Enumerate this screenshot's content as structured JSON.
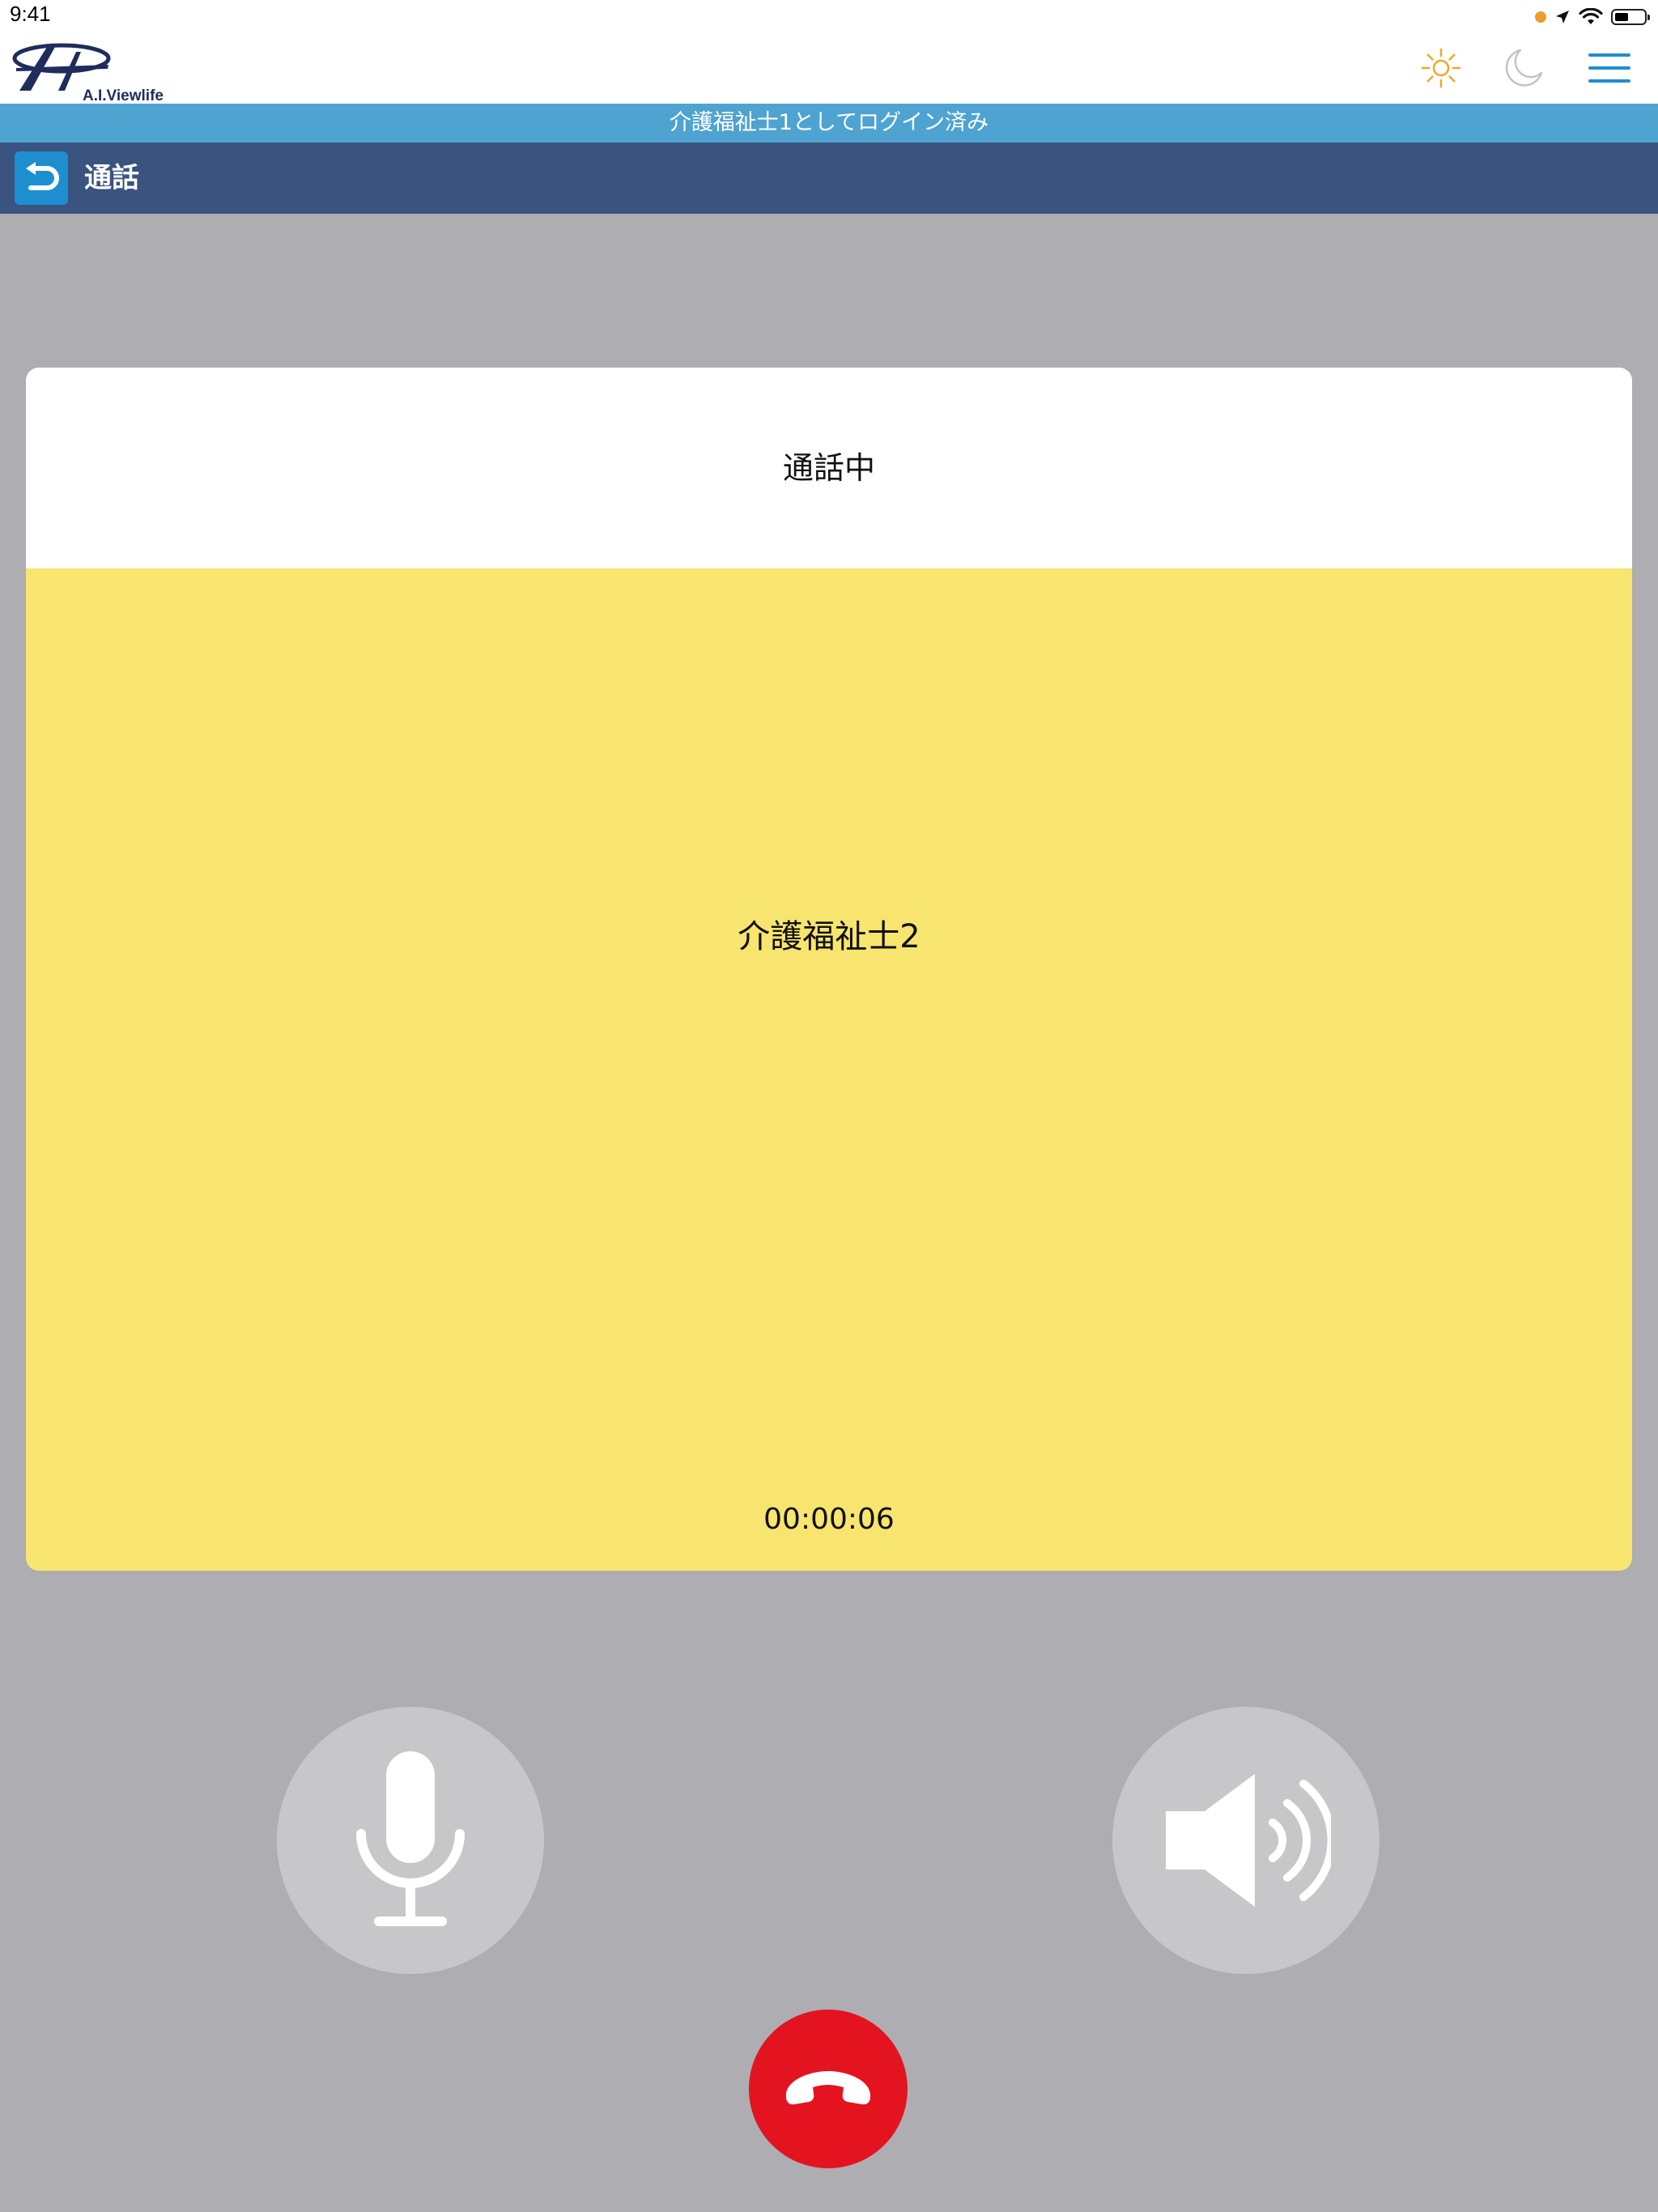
{
  "status_bar": {
    "time": "9:41"
  },
  "header": {
    "logo_text": "A.I.Viewlife",
    "icons": [
      "sun-icon",
      "moon-icon",
      "hamburger-menu-icon"
    ]
  },
  "login_banner": "介護福祉士1としてログイン済み",
  "nav": {
    "title": "通話"
  },
  "call": {
    "status": "通話中",
    "callee": "介護福祉士2",
    "elapsed": "00:00:06"
  },
  "controls": {
    "icons": [
      "microphone-icon",
      "speaker-icon",
      "hangup-phone-icon"
    ]
  },
  "colors": {
    "banner": "#4fa3d1",
    "nav": "#3a537f",
    "back_button": "#1d8fd0",
    "card_body": "#f8e570",
    "background": "#aeadb2",
    "control_button": "#c7c7c9",
    "hangup": "#e41320",
    "sun": "#f0a828",
    "menu": "#1d8fd0"
  }
}
